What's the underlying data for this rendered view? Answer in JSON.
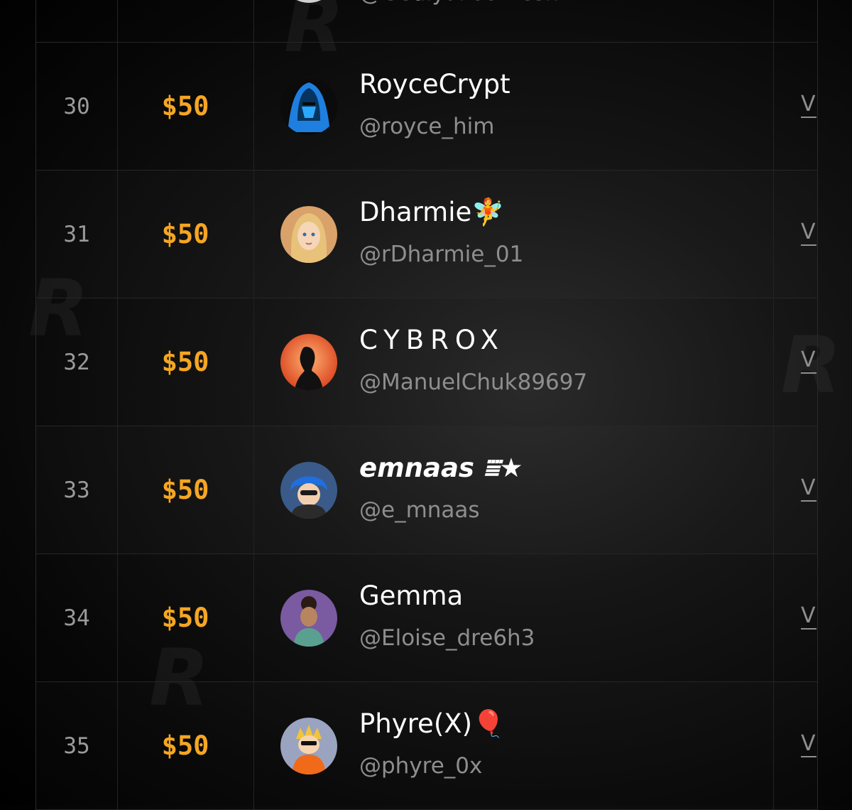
{
  "rows": [
    {
      "rank": "",
      "prize": "",
      "name": "",
      "handle": "@GedlyaPoorvesh",
      "view": "",
      "avatar": "partial-avatar"
    },
    {
      "rank": "30",
      "prize": "$50",
      "name": "RoyceCrypt",
      "handle": "@royce_him",
      "view": "V",
      "avatar": "blue-hooded-avatar"
    },
    {
      "rank": "31",
      "prize": "$50",
      "name": "Dharmie🧚",
      "handle": "@rDharmie_01",
      "view": "V",
      "avatar": "blonde-girl-avatar"
    },
    {
      "rank": "32",
      "prize": "$50",
      "name": "CYBROX",
      "handle": "@ManuelChuk89697",
      "view": "V",
      "avatar": "silhouette-avatar"
    },
    {
      "rank": "33",
      "prize": "$50",
      "name": "emnaas ⩸★",
      "handle": "@e_mnaas",
      "view": "V",
      "avatar": "blue-hair-avatar"
    },
    {
      "rank": "34",
      "prize": "$50",
      "name": "Gemma",
      "handle": "@Eloise_dre6h3",
      "view": "V",
      "avatar": "curly-girl-avatar"
    },
    {
      "rank": "35",
      "prize": "$50",
      "name": "Phyre(X)🎈",
      "handle": "@phyre_0x",
      "view": "V",
      "avatar": "orange-hoodie-avatar"
    }
  ],
  "colors": {
    "prize": "#f5a623",
    "name": "#ffffff",
    "handle": "#8e8e8e"
  }
}
